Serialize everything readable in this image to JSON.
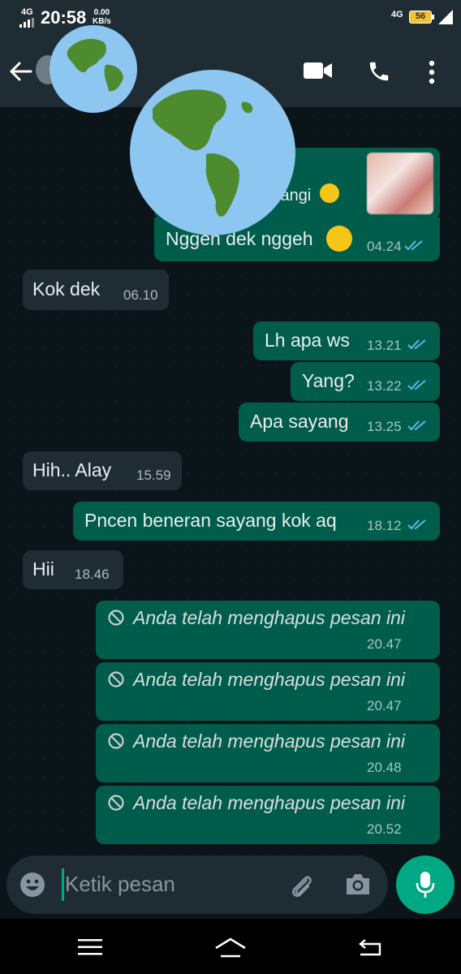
{
  "status_bar": {
    "network_left": "4G",
    "time": "20:58",
    "speed_value": "0.00",
    "speed_unit": "KB/s",
    "network_right": "4G",
    "battery": "56"
  },
  "app_bar": {
    "back_icon": "back-arrow-icon",
    "video_icon": "video-call-icon",
    "call_icon": "phone-icon",
    "menu_icon": "more-vertical-icon"
  },
  "messages": [
    {
      "direction": "out",
      "text": "tangi",
      "time": "",
      "status": "read",
      "has_image": true,
      "emoji": "laughing-emoji"
    },
    {
      "direction": "out",
      "text": "Nggeh dek nggeh",
      "time": "04.24",
      "status": "read",
      "emoji": "laughing-emoji"
    },
    {
      "direction": "in",
      "text": "Kok dek",
      "time": "06.10"
    },
    {
      "direction": "out",
      "text": "Lh apa ws",
      "time": "13.21",
      "status": "read"
    },
    {
      "direction": "out",
      "text": "Yang?",
      "time": "13.22",
      "status": "read"
    },
    {
      "direction": "out",
      "text": "Apa sayang",
      "time": "13.25",
      "status": "read"
    },
    {
      "direction": "in",
      "text": "Hih.. Alay",
      "time": "15.59"
    },
    {
      "direction": "out",
      "text": "Pncen beneran sayang kok aq",
      "time": "18.12",
      "status": "read"
    },
    {
      "direction": "in",
      "text": "Hii",
      "time": "18.46"
    },
    {
      "direction": "out",
      "deleted": true,
      "text": "Anda telah menghapus pesan ini",
      "time": "20.47"
    },
    {
      "direction": "out",
      "deleted": true,
      "text": "Anda telah menghapus pesan ini",
      "time": "20.47"
    },
    {
      "direction": "out",
      "deleted": true,
      "text": "Anda telah menghapus pesan ini",
      "time": "20.48"
    },
    {
      "direction": "out",
      "deleted": true,
      "text": "Anda telah menghapus pesan ini",
      "time": "20.52"
    }
  ],
  "input": {
    "placeholder": "Ketik pesan",
    "emoji_icon": "emoji-icon",
    "attach_icon": "paperclip-icon",
    "camera_icon": "camera-icon",
    "mic_icon": "microphone-icon"
  },
  "nav_bar": {
    "menu_icon": "menu-icon",
    "home_icon": "home-icon",
    "back_icon": "back-icon"
  },
  "colors": {
    "app_bar": "#1f2c33",
    "chat_background": "#0b1418",
    "outgoing_bubble": "#005c4b",
    "incoming_bubble": "#1f2c33",
    "read_ticks": "#53bdeb",
    "mic_button": "#00a884"
  }
}
